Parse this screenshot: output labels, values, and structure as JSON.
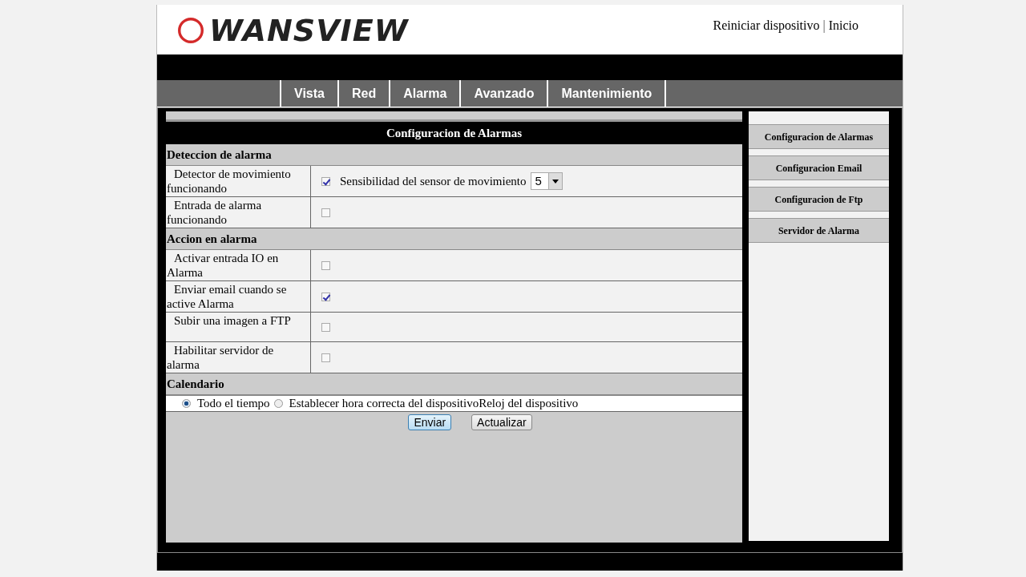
{
  "header": {
    "logo": "WANSVIEW",
    "links": [
      "Reiniciar dispositivo",
      "Inicio"
    ],
    "separator": "|"
  },
  "nav": {
    "tabs": [
      "Vista",
      "Red",
      "Alarma",
      "Avanzado",
      "Mantenimiento"
    ]
  },
  "form": {
    "title": "Configuracion de Alarmas",
    "sections": [
      {
        "heading": "Deteccion de alarma",
        "rows": [
          {
            "label": "Detector de movimiento funcionando",
            "checked": true,
            "extra": {
              "label": "Sensibilidad del sensor de movimiento",
              "value": "5"
            }
          },
          {
            "label": "Entrada de alarma funcionando",
            "checked": false
          }
        ]
      },
      {
        "heading": "Accion en alarma",
        "rows": [
          {
            "label": "Activar entrada IO en Alarma",
            "checked": false
          },
          {
            "label": "Enviar email cuando se active Alarma",
            "checked": true
          },
          {
            "label": "Subir una imagen a FTP",
            "checked": false
          },
          {
            "label": "Habilitar servidor de alarma",
            "checked": false
          }
        ]
      },
      {
        "heading": "Calendario",
        "radios": [
          {
            "label": "Todo el tiempo",
            "selected": true
          },
          {
            "label": "Establecer hora correcta del dispositivoReloj del dispositivo",
            "selected": false
          }
        ]
      }
    ],
    "buttons": [
      {
        "label": "Enviar",
        "highlighted": true
      },
      {
        "label": "Actualizar",
        "highlighted": false
      }
    ]
  },
  "sidebar": {
    "items": [
      "Configuracion de Alarmas",
      "Configuracion Email",
      "Configuracion de Ftp",
      "Servidor de Alarma"
    ]
  }
}
